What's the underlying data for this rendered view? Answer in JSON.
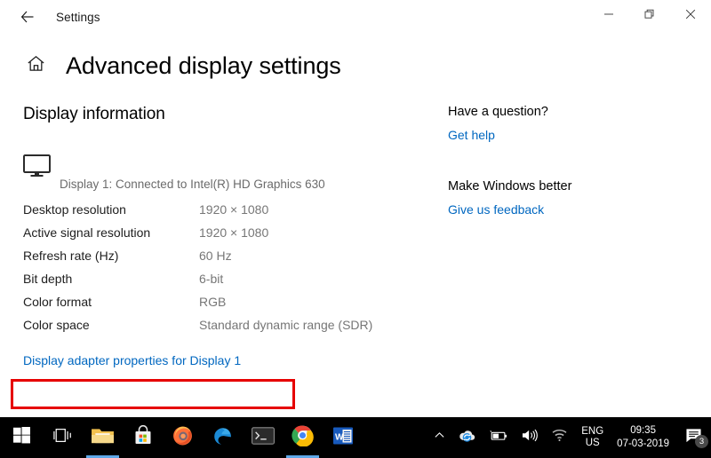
{
  "titlebar": {
    "back_icon": "back-arrow-icon",
    "app_title": "Settings",
    "minimize_label": "─",
    "restore_label": "restore-icon",
    "close_label": "✕"
  },
  "header": {
    "home_icon": "home-icon",
    "page_title": "Advanced display settings"
  },
  "main": {
    "section_title": "Display information",
    "monitor_icon": "monitor-icon",
    "display_caption": "Display 1: Connected to Intel(R) HD Graphics 630",
    "info_rows": [
      {
        "label": "Desktop resolution",
        "value": "1920 × 1080"
      },
      {
        "label": "Active signal resolution",
        "value": "1920 × 1080"
      },
      {
        "label": "Refresh rate (Hz)",
        "value": "60 Hz"
      },
      {
        "label": "Bit depth",
        "value": "6-bit"
      },
      {
        "label": "Color format",
        "value": "RGB"
      },
      {
        "label": "Color space",
        "value": "Standard dynamic range (SDR)"
      }
    ],
    "adapter_link": "Display adapter properties for Display 1"
  },
  "sidebar": {
    "groups": [
      {
        "heading": "Have a question?",
        "link": "Get help"
      },
      {
        "heading": "Make Windows better",
        "link": "Give us feedback"
      }
    ]
  },
  "taskbar": {
    "items": [
      {
        "name": "start-button",
        "icon": "windows-logo-icon",
        "active": false
      },
      {
        "name": "task-view-button",
        "icon": "task-view-icon",
        "active": false
      },
      {
        "name": "file-explorer-button",
        "icon": "folder-icon",
        "active": true
      },
      {
        "name": "microsoft-store-button",
        "icon": "store-bag-icon",
        "active": false
      },
      {
        "name": "firefox-button",
        "icon": "firefox-icon",
        "active": false
      },
      {
        "name": "edge-button",
        "icon": "edge-icon",
        "active": false
      },
      {
        "name": "command-prompt-button",
        "icon": "terminal-icon",
        "active": false
      },
      {
        "name": "chrome-button",
        "icon": "chrome-icon",
        "active": true
      },
      {
        "name": "word-button",
        "icon": "word-icon",
        "active": false
      }
    ],
    "tray": {
      "show_hidden_icon": "chevron-up-icon",
      "onedrive_icon": "onedrive-sync-icon",
      "battery_icon": "battery-icon",
      "volume_icon": "speaker-icon",
      "network_icon": "wifi-icon",
      "language_line1": "ENG",
      "language_line2": "US",
      "time": "09:35",
      "date": "07-03-2019",
      "action_center_icon": "speech-bubble-icon",
      "notification_count": "3"
    }
  },
  "colors": {
    "link": "#0067c0",
    "annotation": "#e60000",
    "taskbar_bg": "#000000",
    "active_underline": "#5fa8e8"
  }
}
